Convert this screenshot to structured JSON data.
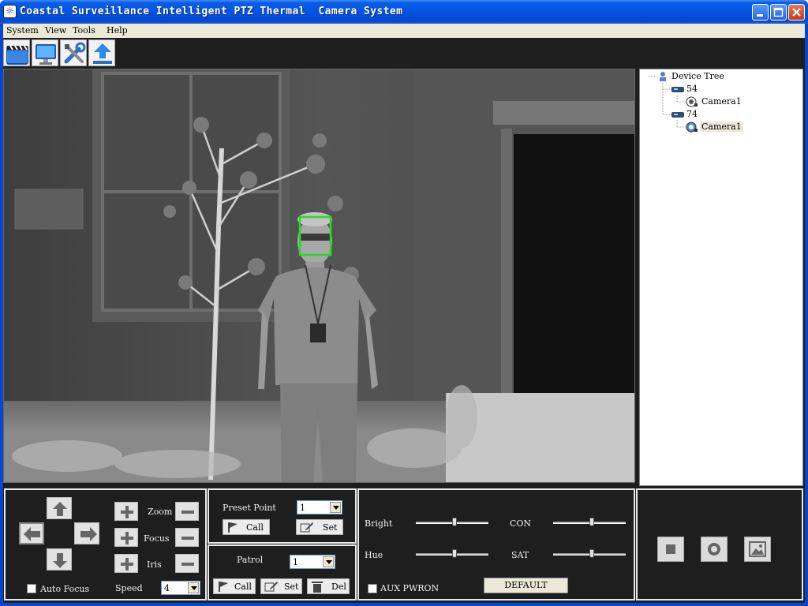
{
  "window": {
    "title": "Coastal Surveillance Intelligent PTZ Thermal  Camera System",
    "icon": "app-logo-icon",
    "controls": [
      "minimize-icon",
      "maximize-icon",
      "close-icon"
    ]
  },
  "menu": {
    "items": [
      {
        "label": "System"
      },
      {
        "label": "View"
      },
      {
        "label": "Tools"
      },
      {
        "label": "Help"
      }
    ]
  },
  "toolbar": {
    "buttons": [
      {
        "icon": "clapperboard-icon",
        "meaning": "preview"
      },
      {
        "icon": "monitor-icon",
        "meaning": "display"
      },
      {
        "icon": "tools-icon",
        "meaning": "settings"
      },
      {
        "icon": "upload-icon",
        "meaning": "upgrade"
      }
    ]
  },
  "device_tree": {
    "root": "Device Tree",
    "devices": [
      {
        "name": "54",
        "cameras": [
          {
            "name": "Camera1",
            "selected": false
          }
        ]
      },
      {
        "name": "74",
        "cameras": [
          {
            "name": "Camera1",
            "selected": true
          }
        ]
      }
    ]
  },
  "ptz": {
    "zoom_label": "Zoom",
    "focus_label": "Focus",
    "iris_label": "Iris",
    "auto_focus_label": "Auto Focus",
    "auto_focus_checked": false,
    "speed_label": "Speed",
    "speed_value": "4"
  },
  "preset": {
    "label": "Preset Point",
    "value": "1",
    "call_label": "Call",
    "set_label": "Set"
  },
  "patrol": {
    "label": "Patrol",
    "value": "1",
    "call_label": "Call",
    "set_label": "Set",
    "del_label": "Del"
  },
  "image": {
    "bright_label": "Bright",
    "bright_level": 0.53,
    "con_label": "CON",
    "con_level": 0.53,
    "hue_label": "Hue",
    "hue_level": 0.53,
    "sat_label": "SAT",
    "sat_level": 0.53,
    "aux_label": "AUX PWRON",
    "aux_checked": false,
    "default_label": "DEFAULT"
  },
  "colors": {
    "titlebar": "#0454e0",
    "panel_bg": "#1e1e1e",
    "detection_box": "#22dd22"
  }
}
